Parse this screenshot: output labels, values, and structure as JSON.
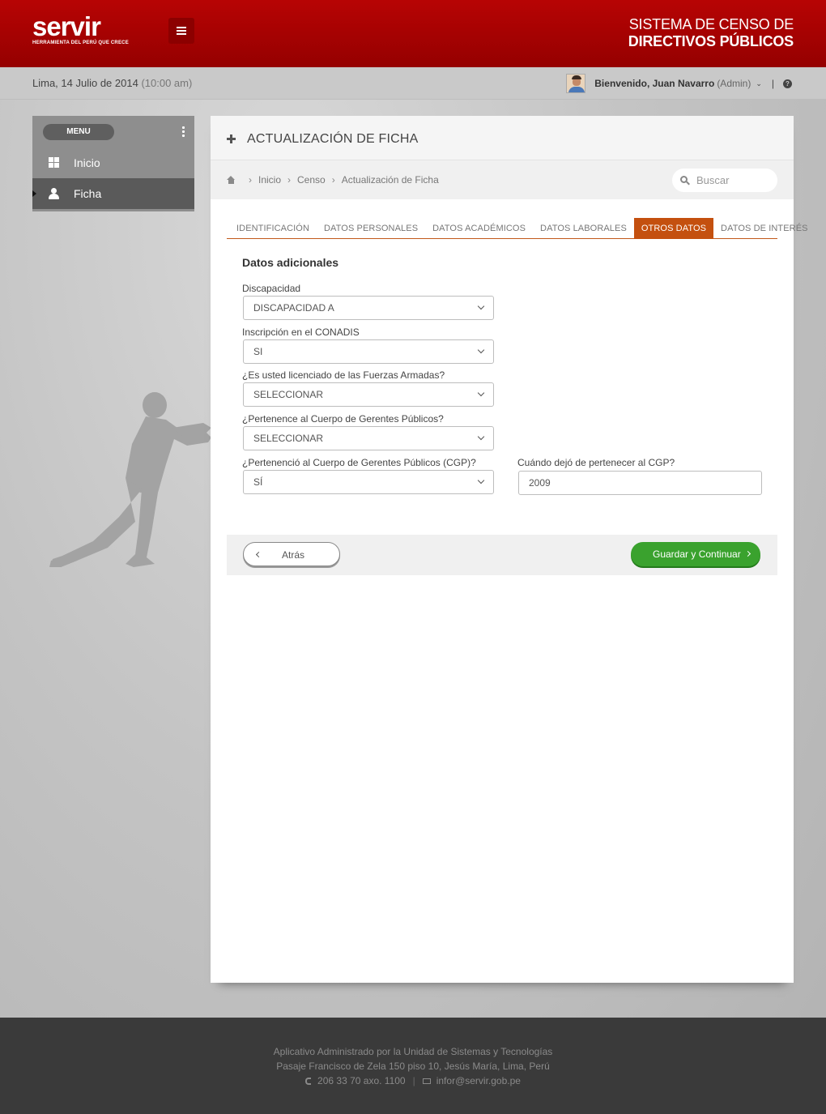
{
  "header": {
    "logo_text": "servir",
    "logo_tagline": "HERRAMIENTA DEL PERÚ QUE CRECE",
    "system_title_line1": "SISTEMA DE CENSO  DE",
    "system_title_line2": "DIRECTIVOS PÚBLICOS",
    "brand_color": "#a80000"
  },
  "subheader": {
    "date": "Lima, 14 Julio de 2014",
    "time": "(10:00 am)",
    "welcome": "Bienvenido, Juan Navarro",
    "role": "(Admin)"
  },
  "sidebar": {
    "menu_label": "MENU",
    "items": [
      {
        "label": "Inicio",
        "icon": "windows-icon",
        "active": false
      },
      {
        "label": "Ficha",
        "icon": "user-icon",
        "active": true
      }
    ]
  },
  "panel": {
    "title": "ACTUALIZACIÓN DE FICHA",
    "breadcrumb": [
      "Inicio",
      "Censo",
      "Actualización de Ficha"
    ],
    "search_placeholder": "Buscar",
    "tabs": [
      {
        "label": "IDENTIFICACIÓN",
        "active": false
      },
      {
        "label": "DATOS PERSONALES",
        "active": false
      },
      {
        "label": "DATOS ACADÉMICOS",
        "active": false
      },
      {
        "label": "DATOS LABORALES",
        "active": false
      },
      {
        "label": "OTROS DATOS",
        "active": true
      },
      {
        "label": "DATOS DE INTERÉS",
        "active": false
      }
    ],
    "accent_color": "#c4500f"
  },
  "form": {
    "section_title": "Datos adicionales",
    "fields": [
      {
        "label": "Discapacidad",
        "value": "DISCAPACIDAD A"
      },
      {
        "label": "Inscripción en el CONADIS",
        "value": "SI"
      },
      {
        "label": "¿Es usted licenciado de las Fuerzas Armadas?",
        "value": "SELECCIONAR"
      },
      {
        "label": "¿Pertenence al Cuerpo de Gerentes Públicos?",
        "value": "SELECCIONAR"
      },
      {
        "label": "¿Pertenenció al Cuerpo de Gerentes Públicos (CGP)?",
        "value": "SÍ"
      }
    ],
    "cgp_end_label": "Cuándo dejó de pertenecer al CGP?",
    "cgp_end_value": "2009"
  },
  "actions": {
    "back_label": "Atrás",
    "save_label": "Guardar y Continuar",
    "save_color": "#3aa22e"
  },
  "footer": {
    "line1": "Aplicativo Administrado por la Unidad de Sistemas y Tecnologías",
    "line2": "Pasaje Francisco de Zela 150 piso 10, Jesús María, Lima, Perú",
    "phone": "206 33 70 axo. 1100",
    "email": "infor@servir.gob.pe"
  }
}
